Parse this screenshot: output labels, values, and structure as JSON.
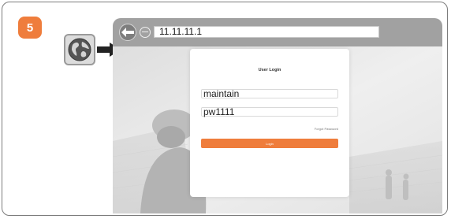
{
  "step": {
    "number": "5"
  },
  "browser": {
    "url": "11.11.11.1"
  },
  "login": {
    "title": "User Login",
    "username": "maintain",
    "password": "pw1111",
    "forgot_password": "Forgot Password",
    "login_button": "Login"
  },
  "icons": {
    "globe": "globe-icon",
    "pointer": "arrow-right-icon",
    "back": "back-arrow-icon",
    "stop": "stop-icon"
  },
  "colors": {
    "accent": "#ef7d3c",
    "address_bar": "#a1a1a1"
  }
}
